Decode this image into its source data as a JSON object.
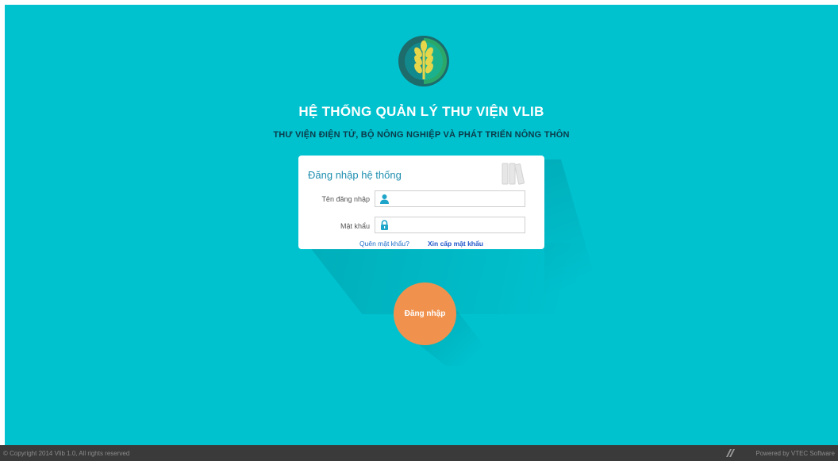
{
  "header": {
    "title": "HỆ THỐNG QUẢN LÝ THƯ VIỆN VLIB",
    "subtitle": "THƯ VIỆN ĐIỆN TỬ, BỘ NÔNG NGHIỆP VÀ PHÁT TRIỂN NÔNG THÔN"
  },
  "login_card": {
    "title": "Đăng nhập hệ thống",
    "username_label": "Tên đăng nhập",
    "username_value": "",
    "password_label": "Mật khẩu",
    "password_value": "",
    "forgot_link": "Quên mật khẩu?",
    "request_link": "Xin cấp mật khẩu",
    "icons": {
      "username": "user-icon",
      "password": "lock-icon",
      "decor": "books-icon"
    }
  },
  "login_button": {
    "label": "Đăng nhập"
  },
  "footer": {
    "copyright": "© Copyright 2014 Vlib 1.0, All rights reserved",
    "powered_by": "Powered by VTEC Software"
  },
  "colors": {
    "background": "#00c2cf",
    "accent_button": "#f0924e",
    "footer": "#3a3a3a",
    "subtitle": "#0c3b4a"
  }
}
